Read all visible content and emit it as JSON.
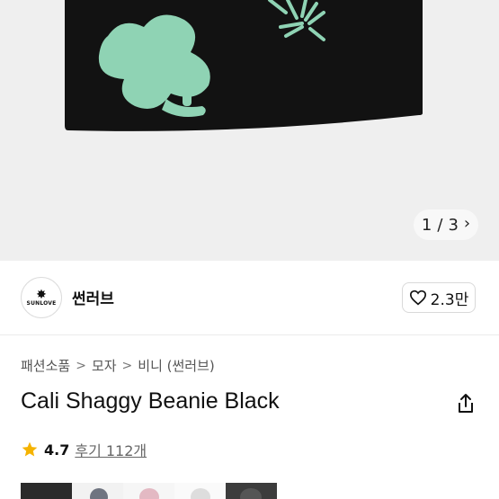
{
  "gallery": {
    "current": "1",
    "separator": "/",
    "total": "3",
    "bg_color": "#efefef",
    "beanie_color": "#121212",
    "pattern_color": "#8fd3b4"
  },
  "brand": {
    "logo_text": "SUNLOVE",
    "name": "썬러브",
    "like_count": "2.3만"
  },
  "breadcrumb": {
    "items": [
      "패션소품",
      "모자",
      "비니 (썬러브)"
    ],
    "separator": ">"
  },
  "product": {
    "title": "Cali Shaggy Beanie Black"
  },
  "rating": {
    "score": "4.7",
    "reviews": "후기 112개",
    "star_color": "#f5b301"
  },
  "thumbnails": {
    "colors": [
      "#2b2b2b",
      "#6f7480",
      "#e3b9c3",
      "#dddddd",
      "#3c3c3c",
      "#ffffff"
    ]
  }
}
